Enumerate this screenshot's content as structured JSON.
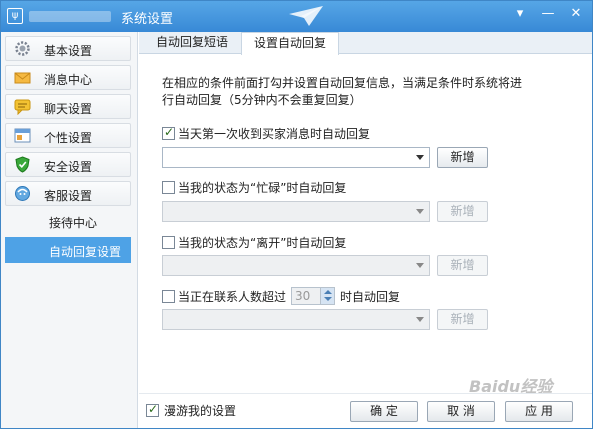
{
  "window": {
    "title": "系统设置",
    "icon_text": "ψ",
    "controls": [
      "▾",
      "—",
      "✕"
    ]
  },
  "sidebar": {
    "items": [
      {
        "label": "基本设置",
        "icon": "gear-icon"
      },
      {
        "label": "消息中心",
        "icon": "envelope-icon"
      },
      {
        "label": "聊天设置",
        "icon": "chat-bubble-icon"
      },
      {
        "label": "个性设置",
        "icon": "personalize-icon"
      },
      {
        "label": "安全设置",
        "icon": "shield-icon"
      },
      {
        "label": "客服设置",
        "icon": "customer-service-icon"
      }
    ],
    "subitems": [
      {
        "label": "接待中心",
        "active": false
      },
      {
        "label": "自动回复设置",
        "active": true
      }
    ]
  },
  "tabs": [
    {
      "label": "自动回复短语",
      "active": false
    },
    {
      "label": "设置自动回复",
      "active": true
    }
  ],
  "main": {
    "description": "在相应的条件前面打勾并设置自动回复信息，当满足条件时系统将进行自动回复（5分钟内不会重复回复）",
    "rules": [
      {
        "label": "当天第一次收到买家消息时自动回复",
        "checked": true,
        "button": "新增",
        "enabled": true
      },
      {
        "label": "当我的状态为“忙碌”时自动回复",
        "checked": false,
        "button": "新增",
        "enabled": false
      },
      {
        "label": "当我的状态为“离开”时自动回复",
        "checked": false,
        "button": "新增",
        "enabled": false
      },
      {
        "label_prefix": "当正在联系人数超过",
        "spin_value": "30",
        "label_suffix": "时自动回复",
        "checked": false,
        "button": "新增",
        "enabled": false
      }
    ]
  },
  "footer": {
    "roam_label": "漫游我的设置",
    "roam_checked": true,
    "ok": "确 定",
    "cancel": "取 消",
    "apply": "应 用"
  },
  "watermark": "Baidu经验",
  "colors": {
    "titlebar": "#3f8ed9",
    "active_nav": "#4ea2e6"
  }
}
